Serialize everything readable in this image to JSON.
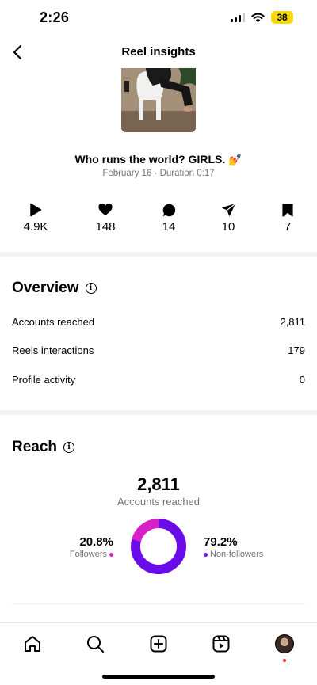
{
  "status_bar": {
    "time": "2:26",
    "battery": "38"
  },
  "header": {
    "title": "Reel insights"
  },
  "reel": {
    "caption": "Who runs the world? GIRLS. 💅",
    "meta": "February 16 · Duration 0:17"
  },
  "stats": {
    "plays": "4.9K",
    "likes": "148",
    "comments": "14",
    "shares": "10",
    "saves": "7"
  },
  "overview": {
    "title": "Overview",
    "rows": [
      {
        "label": "Accounts reached",
        "value": "2,811"
      },
      {
        "label": "Reels interactions",
        "value": "179"
      },
      {
        "label": "Profile activity",
        "value": "0"
      }
    ]
  },
  "reach": {
    "title": "Reach",
    "total": "2,811",
    "total_label": "Accounts reached",
    "followers_pct": "20.8%",
    "followers_label": "Followers",
    "followers_fraction": 0.208,
    "non_followers_pct": "79.2%",
    "non_followers_label": "Non-followers",
    "non_followers_fraction": 0.792
  },
  "colors": {
    "followers": "#d91fc7",
    "non_followers": "#6a0bea",
    "muted": "#737373"
  },
  "icons": {
    "back": "chevron-left-icon",
    "plays": "play-icon",
    "likes": "heart-icon",
    "comments": "comment-icon",
    "shares": "send-icon",
    "saves": "bookmark-icon",
    "info": "info-icon",
    "nav_home": "home-icon",
    "nav_search": "search-icon",
    "nav_create": "plus-square-icon",
    "nav_reels": "reels-icon",
    "nav_profile": "avatar"
  }
}
